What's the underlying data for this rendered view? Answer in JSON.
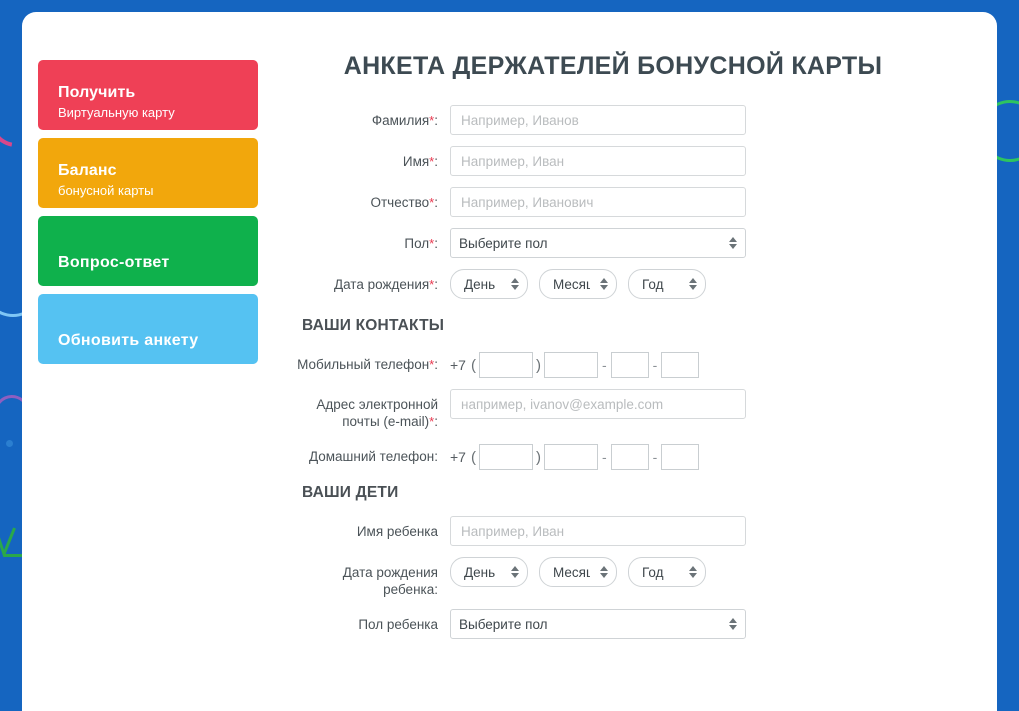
{
  "page": {
    "title": "АНКЕТА ДЕРЖАТЕЛЕЙ БОНУСНОЙ КАРТЫ",
    "background_color": "#1565c0",
    "card_color": "#ffffff",
    "required_marker": "*"
  },
  "sidebar": {
    "buttons": [
      {
        "title": "Получить",
        "subtitle": "Виртуальную карту",
        "color": "#ef4056"
      },
      {
        "title": "Баланс",
        "subtitle": "бонусной карты",
        "color": "#f2a70c"
      },
      {
        "title": "Вопрос-ответ",
        "subtitle": "",
        "color": "#0fb14c"
      },
      {
        "title": "Обновить анкету",
        "subtitle": "",
        "color": "#55c2f2"
      }
    ]
  },
  "form": {
    "personal": {
      "surname": {
        "label": "Фамилия",
        "placeholder": "Например, Иванов",
        "value": "",
        "required": true
      },
      "firstname": {
        "label": "Имя",
        "placeholder": "Например, Иван",
        "value": "",
        "required": true
      },
      "patronymic": {
        "label": "Отчество",
        "placeholder": "Например, Иванович",
        "value": "",
        "required": true
      },
      "gender": {
        "label": "Пол",
        "selected": "Выберите пол",
        "required": true
      },
      "birthdate": {
        "label": "Дата рождения",
        "required": true,
        "day": "День",
        "month": "Месяц",
        "year": "Год"
      }
    },
    "contacts": {
      "heading": "ВАШИ КОНТАКТЫ",
      "mobile": {
        "label": "Мобильный телефон",
        "required": true,
        "prefix": "+7",
        "open_paren": "(",
        "close_paren": ")",
        "dash": "-",
        "parts": [
          "",
          "",
          "",
          ""
        ]
      },
      "email": {
        "label": "Адрес электронной почты (e-mail)",
        "label_line1": "Адрес электронной",
        "label_line2": "почты (e-mail)",
        "placeholder": "например, ivanov@example.com",
        "value": "",
        "required": true
      },
      "homephone": {
        "label": "Домашний телефон",
        "required": false,
        "prefix": "+7",
        "open_paren": "(",
        "close_paren": ")",
        "dash": "-",
        "parts": [
          "",
          "",
          "",
          ""
        ]
      }
    },
    "children": {
      "heading": "ВАШИ ДЕТИ",
      "child_name": {
        "label": "Имя ребенка",
        "placeholder": "Например, Иван",
        "value": "",
        "required": false
      },
      "child_birthdate": {
        "label": "Дата рождения ребенка",
        "label_line1": "Дата рождения",
        "label_line2": "ребенка",
        "required": false,
        "day": "День",
        "month": "Месяц",
        "year": "Год"
      },
      "child_gender": {
        "label": "Пол ребенка",
        "selected": "Выберите пол",
        "required": false
      }
    }
  }
}
